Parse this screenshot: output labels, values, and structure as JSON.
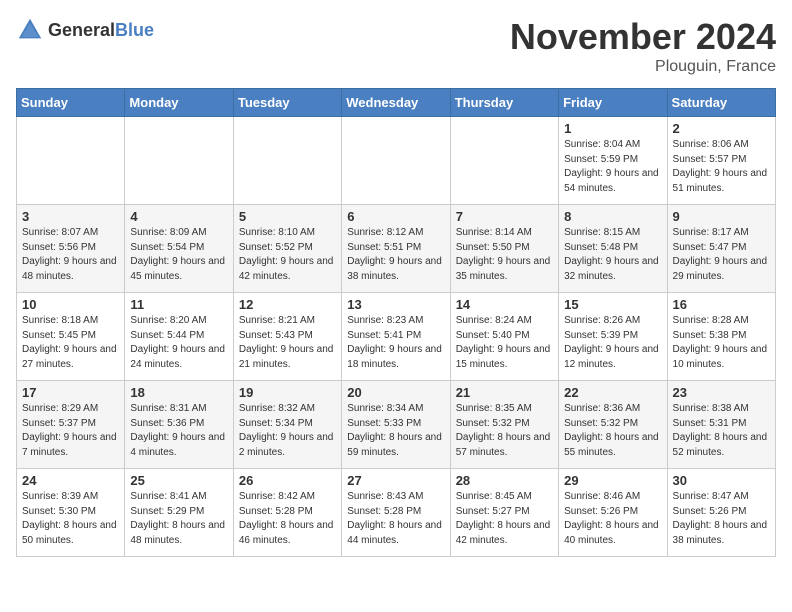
{
  "header": {
    "logo_general": "General",
    "logo_blue": "Blue",
    "month_title": "November 2024",
    "location": "Plouguin, France"
  },
  "days_of_week": [
    "Sunday",
    "Monday",
    "Tuesday",
    "Wednesday",
    "Thursday",
    "Friday",
    "Saturday"
  ],
  "weeks": [
    [
      {
        "day": "",
        "info": ""
      },
      {
        "day": "",
        "info": ""
      },
      {
        "day": "",
        "info": ""
      },
      {
        "day": "",
        "info": ""
      },
      {
        "day": "",
        "info": ""
      },
      {
        "day": "1",
        "info": "Sunrise: 8:04 AM\nSunset: 5:59 PM\nDaylight: 9 hours and 54 minutes."
      },
      {
        "day": "2",
        "info": "Sunrise: 8:06 AM\nSunset: 5:57 PM\nDaylight: 9 hours and 51 minutes."
      }
    ],
    [
      {
        "day": "3",
        "info": "Sunrise: 8:07 AM\nSunset: 5:56 PM\nDaylight: 9 hours and 48 minutes."
      },
      {
        "day": "4",
        "info": "Sunrise: 8:09 AM\nSunset: 5:54 PM\nDaylight: 9 hours and 45 minutes."
      },
      {
        "day": "5",
        "info": "Sunrise: 8:10 AM\nSunset: 5:52 PM\nDaylight: 9 hours and 42 minutes."
      },
      {
        "day": "6",
        "info": "Sunrise: 8:12 AM\nSunset: 5:51 PM\nDaylight: 9 hours and 38 minutes."
      },
      {
        "day": "7",
        "info": "Sunrise: 8:14 AM\nSunset: 5:50 PM\nDaylight: 9 hours and 35 minutes."
      },
      {
        "day": "8",
        "info": "Sunrise: 8:15 AM\nSunset: 5:48 PM\nDaylight: 9 hours and 32 minutes."
      },
      {
        "day": "9",
        "info": "Sunrise: 8:17 AM\nSunset: 5:47 PM\nDaylight: 9 hours and 29 minutes."
      }
    ],
    [
      {
        "day": "10",
        "info": "Sunrise: 8:18 AM\nSunset: 5:45 PM\nDaylight: 9 hours and 27 minutes."
      },
      {
        "day": "11",
        "info": "Sunrise: 8:20 AM\nSunset: 5:44 PM\nDaylight: 9 hours and 24 minutes."
      },
      {
        "day": "12",
        "info": "Sunrise: 8:21 AM\nSunset: 5:43 PM\nDaylight: 9 hours and 21 minutes."
      },
      {
        "day": "13",
        "info": "Sunrise: 8:23 AM\nSunset: 5:41 PM\nDaylight: 9 hours and 18 minutes."
      },
      {
        "day": "14",
        "info": "Sunrise: 8:24 AM\nSunset: 5:40 PM\nDaylight: 9 hours and 15 minutes."
      },
      {
        "day": "15",
        "info": "Sunrise: 8:26 AM\nSunset: 5:39 PM\nDaylight: 9 hours and 12 minutes."
      },
      {
        "day": "16",
        "info": "Sunrise: 8:28 AM\nSunset: 5:38 PM\nDaylight: 9 hours and 10 minutes."
      }
    ],
    [
      {
        "day": "17",
        "info": "Sunrise: 8:29 AM\nSunset: 5:37 PM\nDaylight: 9 hours and 7 minutes."
      },
      {
        "day": "18",
        "info": "Sunrise: 8:31 AM\nSunset: 5:36 PM\nDaylight: 9 hours and 4 minutes."
      },
      {
        "day": "19",
        "info": "Sunrise: 8:32 AM\nSunset: 5:34 PM\nDaylight: 9 hours and 2 minutes."
      },
      {
        "day": "20",
        "info": "Sunrise: 8:34 AM\nSunset: 5:33 PM\nDaylight: 8 hours and 59 minutes."
      },
      {
        "day": "21",
        "info": "Sunrise: 8:35 AM\nSunset: 5:32 PM\nDaylight: 8 hours and 57 minutes."
      },
      {
        "day": "22",
        "info": "Sunrise: 8:36 AM\nSunset: 5:32 PM\nDaylight: 8 hours and 55 minutes."
      },
      {
        "day": "23",
        "info": "Sunrise: 8:38 AM\nSunset: 5:31 PM\nDaylight: 8 hours and 52 minutes."
      }
    ],
    [
      {
        "day": "24",
        "info": "Sunrise: 8:39 AM\nSunset: 5:30 PM\nDaylight: 8 hours and 50 minutes."
      },
      {
        "day": "25",
        "info": "Sunrise: 8:41 AM\nSunset: 5:29 PM\nDaylight: 8 hours and 48 minutes."
      },
      {
        "day": "26",
        "info": "Sunrise: 8:42 AM\nSunset: 5:28 PM\nDaylight: 8 hours and 46 minutes."
      },
      {
        "day": "27",
        "info": "Sunrise: 8:43 AM\nSunset: 5:28 PM\nDaylight: 8 hours and 44 minutes."
      },
      {
        "day": "28",
        "info": "Sunrise: 8:45 AM\nSunset: 5:27 PM\nDaylight: 8 hours and 42 minutes."
      },
      {
        "day": "29",
        "info": "Sunrise: 8:46 AM\nSunset: 5:26 PM\nDaylight: 8 hours and 40 minutes."
      },
      {
        "day": "30",
        "info": "Sunrise: 8:47 AM\nSunset: 5:26 PM\nDaylight: 8 hours and 38 minutes."
      }
    ]
  ]
}
